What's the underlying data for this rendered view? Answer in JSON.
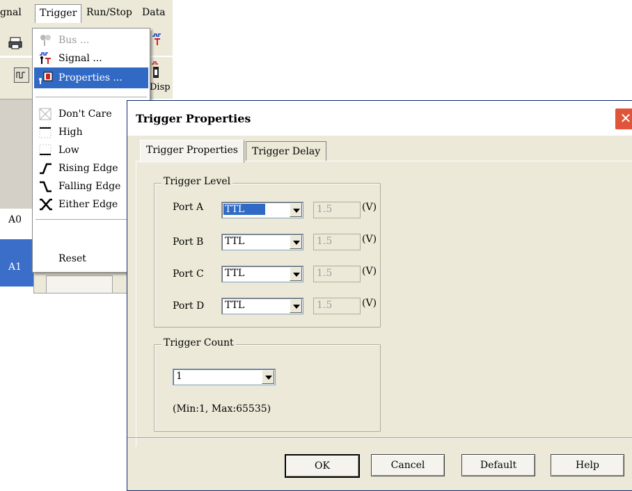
{
  "menubar": {
    "items": [
      {
        "label": "gnal"
      },
      {
        "label": "Trigger"
      },
      {
        "label": "Run/Stop"
      },
      {
        "label": "Data"
      }
    ]
  },
  "toolbar": {
    "partial_label": "Disp"
  },
  "background": {
    "row_labels": [
      "A0",
      "A1"
    ]
  },
  "trigger_menu": {
    "items": [
      {
        "label": "Bus ...",
        "icon": "bus-icon",
        "disabled": true
      },
      {
        "label": "Signal ...",
        "icon": "signal-icon",
        "disabled": false
      },
      {
        "label": "Properties ...",
        "icon": "properties-icon",
        "highlighted": true
      },
      {
        "label": "Don't Care",
        "icon": "dont-care-icon"
      },
      {
        "label": "High",
        "icon": "high-icon"
      },
      {
        "label": "Low",
        "icon": "low-icon"
      },
      {
        "label": "Rising Edge",
        "icon": "rising-edge-icon"
      },
      {
        "label": "Falling Edge",
        "icon": "falling-edge-icon"
      },
      {
        "label": "Either Edge",
        "icon": "either-edge-icon"
      },
      {
        "label": "Reset",
        "icon": ""
      }
    ]
  },
  "dialog": {
    "title": "Trigger Properties",
    "close": "✕",
    "tabs": [
      {
        "label": "Trigger Properties",
        "active": true
      },
      {
        "label": "Trigger Delay",
        "active": false
      }
    ],
    "trigger_level": {
      "title": "Trigger Level",
      "ports": [
        {
          "label": "Port A",
          "mode": "TTL",
          "voltage": "1.5",
          "unit": "(V)",
          "focused": true
        },
        {
          "label": "Port B",
          "mode": "TTL",
          "voltage": "1.5",
          "unit": "(V)"
        },
        {
          "label": "Port C",
          "mode": "TTL",
          "voltage": "1.5",
          "unit": "(V)"
        },
        {
          "label": "Port D",
          "mode": "TTL",
          "voltage": "1.5",
          "unit": "(V)"
        }
      ]
    },
    "trigger_count": {
      "title": "Trigger Count",
      "value": "1",
      "range_hint": "(Min:1, Max:65535)"
    },
    "buttons": {
      "ok": "OK",
      "cancel": "Cancel",
      "default": "Default",
      "help": "Help"
    }
  },
  "colors": {
    "highlight": "#316ac5",
    "dialog_bg": "#ece9d8",
    "close": "#e0553a"
  }
}
